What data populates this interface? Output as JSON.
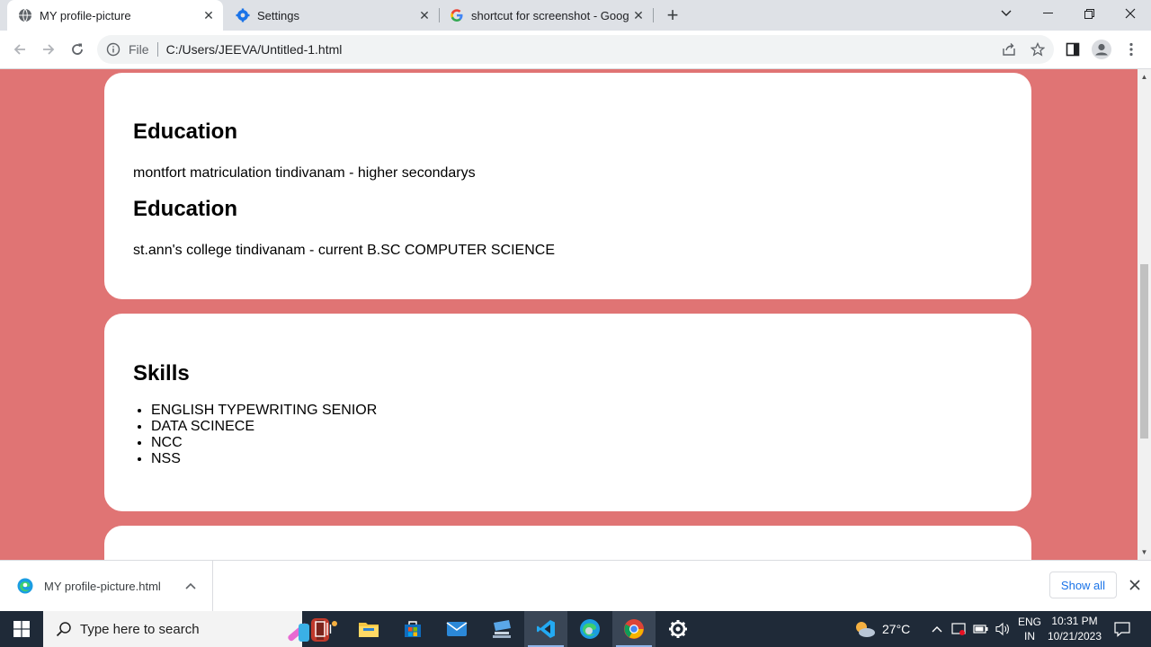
{
  "browser": {
    "tabs": [
      {
        "title": "MY profile-picture",
        "active": true,
        "icon": "globe-icon"
      },
      {
        "title": "Settings",
        "active": false,
        "icon": "gear-icon"
      },
      {
        "title": "shortcut for screenshot - Google",
        "active": false,
        "icon": "google-icon"
      }
    ],
    "address": {
      "scheme_label": "File",
      "url": "C:/Users/JEEVA/Untitled-1.html"
    }
  },
  "page": {
    "background_color": "#e07474",
    "cards": [
      {
        "sections": [
          {
            "heading": "Education",
            "text": "montfort matriculation tindivanam - higher secondarys"
          },
          {
            "heading": "Education",
            "text": "st.ann's college tindivanam - current B.SC COMPUTER SCIENCE"
          }
        ]
      },
      {
        "heading": "Skills",
        "items": [
          "ENGLISH TYPEWRITING SENIOR",
          "DATA SCINECE",
          "NCC",
          "NSS"
        ]
      }
    ]
  },
  "downloads": {
    "file_name": "MY profile-picture.html",
    "show_all_label": "Show all"
  },
  "taskbar": {
    "search_placeholder": "Type here to search",
    "weather": "27°C",
    "language": "ENG",
    "region": "IN",
    "time": "10:31 PM",
    "date": "10/21/2023"
  }
}
